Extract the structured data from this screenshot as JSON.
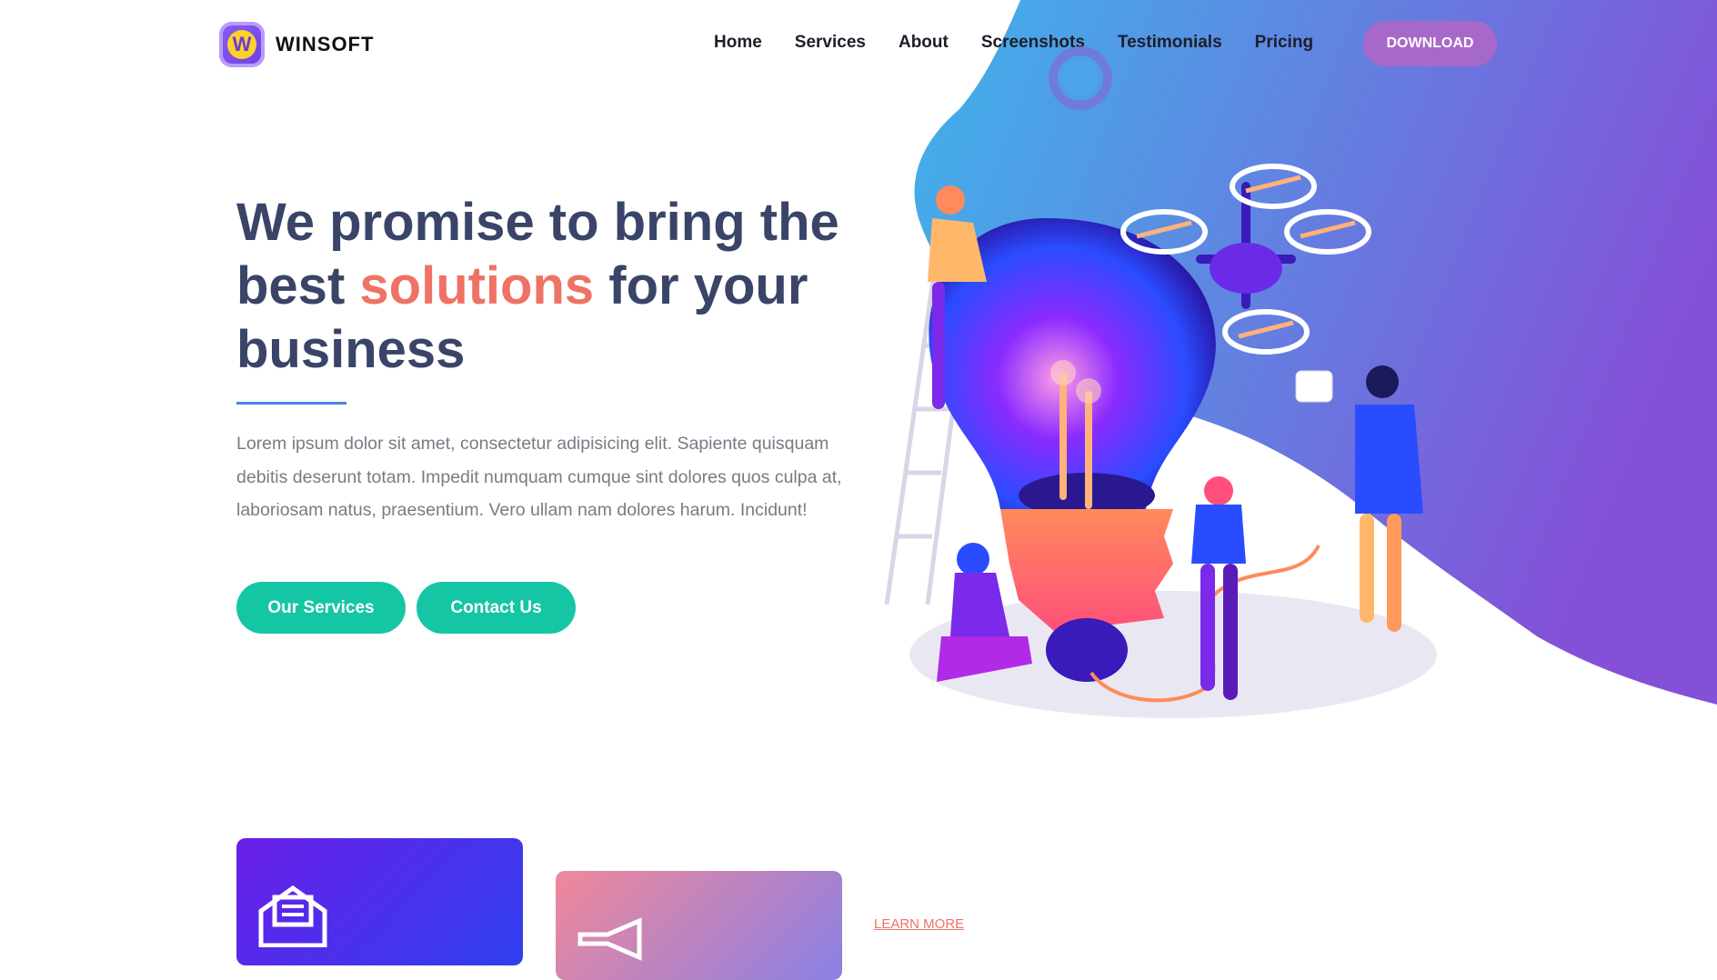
{
  "brand": {
    "name": "WINSOFT",
    "mark": "W"
  },
  "nav": {
    "items": [
      "Home",
      "Services",
      "About",
      "Screenshots",
      "Testimonials",
      "Pricing"
    ],
    "download_label": "DOWNLOAD"
  },
  "hero": {
    "title_part1": "We promise to bring the best",
    "title_accent": "solutions",
    "title_part2": "for your business",
    "description": "Lorem ipsum dolor sit amet, consectetur adipisicing elit. Sapiente quisquam debitis deserunt totam. Impedit numquam cumque sint dolores quos culpa at, laboriosam natus, praesentium. Vero ullam nam dolores harum. Incidunt!",
    "primary_button": "Our Services",
    "secondary_button": "Contact Us"
  },
  "services": {
    "learn_more": "LEARN MORE"
  },
  "colors": {
    "heading": "#3a4468",
    "accent": "#ee7365",
    "button": "#14c6a4",
    "download": "#a769c9",
    "blob_start": "#3fb4ea",
    "blob_end": "#8450d8"
  }
}
